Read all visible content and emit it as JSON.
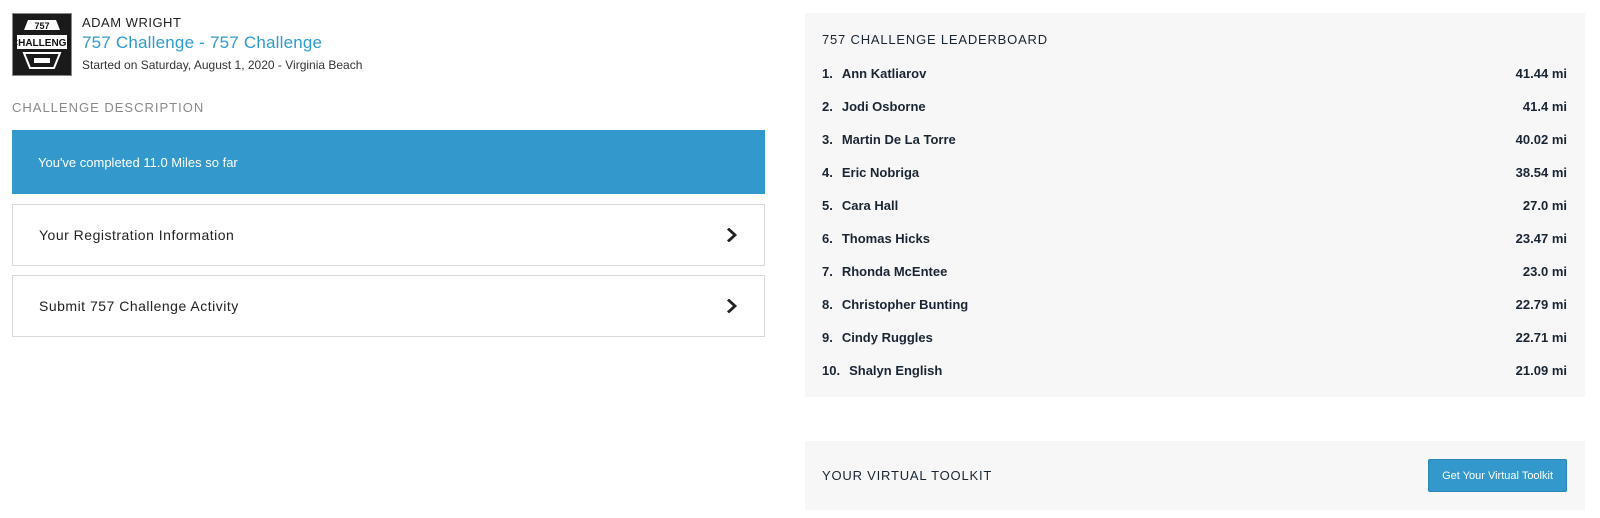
{
  "profile": {
    "user_name": "ADAM WRIGHT",
    "challenge_title": "757 Challenge - 757 Challenge",
    "started": "Started on Saturday, August 1, 2020 - Virginia Beach",
    "logo_text_top": "757",
    "logo_text_main": "CHALLENGE"
  },
  "description": {
    "heading": "CHALLENGE DESCRIPTION",
    "progress_text": "You've completed 11.0 Miles so far"
  },
  "actions": [
    {
      "label": "Your Registration Information"
    },
    {
      "label": "Submit 757 Challenge Activity"
    }
  ],
  "leaderboard": {
    "title": "757 CHALLENGE LEADERBOARD",
    "entries": [
      {
        "rank": "1.",
        "name": "Ann Katliarov",
        "distance": "41.44 mi"
      },
      {
        "rank": "2.",
        "name": "Jodi Osborne",
        "distance": "41.4 mi"
      },
      {
        "rank": "3.",
        "name": "Martin De La Torre",
        "distance": "40.02 mi"
      },
      {
        "rank": "4.",
        "name": "Eric Nobriga",
        "distance": "38.54 mi"
      },
      {
        "rank": "5.",
        "name": "Cara Hall",
        "distance": "27.0 mi"
      },
      {
        "rank": "6.",
        "name": "Thomas Hicks",
        "distance": "23.47 mi"
      },
      {
        "rank": "7.",
        "name": "Rhonda McEntee",
        "distance": "23.0 mi"
      },
      {
        "rank": "8.",
        "name": "Christopher Bunting",
        "distance": "22.79 mi"
      },
      {
        "rank": "9.",
        "name": "Cindy Ruggles",
        "distance": "22.71 mi"
      },
      {
        "rank": "10.",
        "name": "Shalyn English",
        "distance": "21.09 mi"
      }
    ]
  },
  "toolkit": {
    "title": "YOUR VIRTUAL TOOLKIT",
    "button_label": "Get Your Virtual Toolkit"
  },
  "colors": {
    "accent": "#3399cc",
    "link": "#2f9ad0",
    "panel_bg": "#f7f7f7",
    "text_dark": "#1a2533"
  },
  "icons": {
    "row_chevron": "chevron-right-icon",
    "logo": "challenge-logo"
  }
}
